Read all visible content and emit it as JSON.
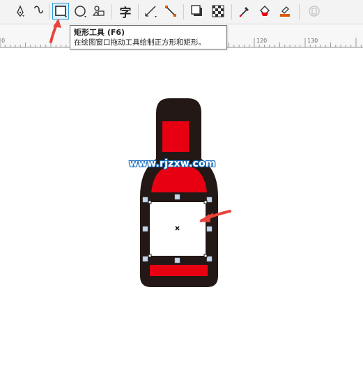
{
  "toolbar": {
    "tools": [
      {
        "name": "pen-tool-icon"
      },
      {
        "name": "artistic-media-icon"
      },
      {
        "name": "rectangle-tool-icon",
        "active": true
      },
      {
        "name": "ellipse-tool-icon"
      },
      {
        "name": "basic-shapes-icon"
      },
      {
        "name": "text-tool-icon",
        "glyph": "字"
      },
      {
        "name": "parallel-dimension-icon"
      },
      {
        "name": "connector-tool-icon"
      },
      {
        "name": "drop-shadow-icon"
      },
      {
        "name": "transparency-icon"
      },
      {
        "name": "eyedropper-icon"
      },
      {
        "name": "interactive-fill-icon"
      },
      {
        "name": "smart-fill-icon"
      },
      {
        "name": "disabled-tool-icon"
      }
    ],
    "accent_color": "#2a9bd7"
  },
  "ruler": {
    "labels": [
      "0",
      "120",
      "130"
    ]
  },
  "tooltip": {
    "title": "矩形工具 (F6)",
    "description": "在绘图窗口拖动工具绘制正方形和矩形。"
  },
  "canvas": {
    "watermark": "www.rjzxw.com",
    "colors": {
      "outline": "#231815",
      "red": "#e60012",
      "white": "#ffffff",
      "arrow": "#e8453c",
      "handle": "#b9cde0"
    }
  }
}
